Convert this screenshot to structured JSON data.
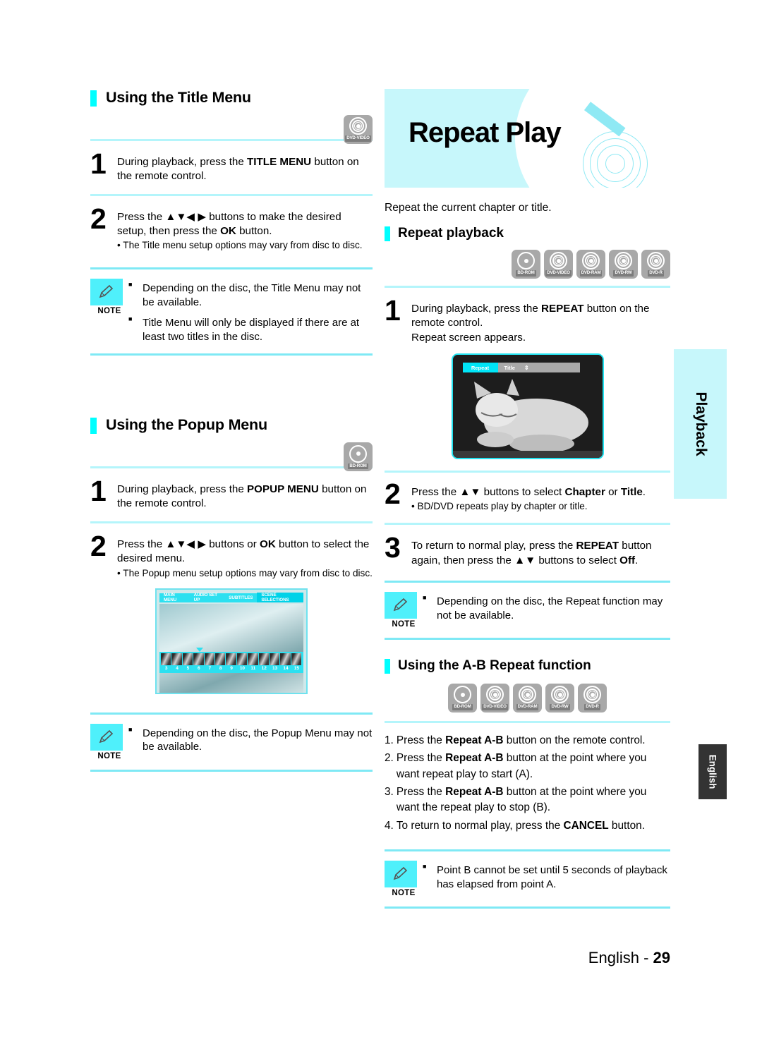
{
  "left_column": {
    "section1": {
      "heading": "Using the Title Menu",
      "disc_icon": "DVD-VIDEO",
      "steps": [
        {
          "num": "1",
          "text_parts": [
            "During playback, press the ",
            "TITLE MENU",
            " button on the remote control."
          ]
        },
        {
          "num": "2",
          "text_parts": [
            "Press the ▲▼◀ ▶ buttons to make the desired setup, then press the ",
            "OK",
            " button."
          ],
          "sub": "• The Title menu setup options may vary from disc to disc."
        }
      ],
      "note": {
        "label": "NOTE",
        "items": [
          "Depending on the disc, the Title Menu may not be available.",
          "Title Menu will only be displayed if there are at least two titles in the disc."
        ]
      }
    },
    "section2": {
      "heading": "Using the Popup Menu",
      "disc_icon": "BD-ROM",
      "steps": [
        {
          "num": "1",
          "text_parts": [
            "During playback, press the ",
            "POPUP MENU",
            " button on the remote control."
          ]
        },
        {
          "num": "2",
          "text_parts": [
            "Press the ▲▼◀ ▶ buttons or ",
            "OK",
            " button to select the desired menu."
          ],
          "sub": "• The Popup menu setup options may vary from disc to disc."
        }
      ],
      "screenshot": {
        "menu_tabs": [
          "MAIN MENU",
          "AUDIO SET UP",
          "SUBTITLES",
          "SCENE SELECTIONS"
        ],
        "active_tab": "SCENE SELECTIONS",
        "scene_numbers": [
          "3",
          "4",
          "5",
          "6",
          "7",
          "8",
          "9",
          "10",
          "11",
          "12",
          "13",
          "14",
          "15"
        ]
      },
      "note": {
        "label": "NOTE",
        "items": [
          "Depending on the disc, the Popup Menu may not be available."
        ]
      }
    }
  },
  "right_column": {
    "banner_title": "Repeat Play",
    "intro": "Repeat the current chapter or title.",
    "section1": {
      "heading": "Repeat playback",
      "disc_icons": [
        "BD-ROM",
        "DVD-VIDEO",
        "DVD-RAM",
        "DVD-RW",
        "DVD-R"
      ],
      "steps": [
        {
          "num": "1",
          "text_parts": [
            "During playback, press the ",
            "REPEAT",
            " button on the remote control."
          ],
          "extra": "Repeat screen appears."
        },
        {
          "num": "2",
          "text_parts": [
            "Press the ▲▼ buttons to select ",
            "Chapter",
            " or ",
            "Title",
            "."
          ],
          "sub": "• BD/DVD repeats play by chapter or title."
        },
        {
          "num": "3",
          "text_parts": [
            "To return to normal play, press the ",
            "REPEAT",
            " button again, then press the ▲▼ buttons to select ",
            "Off",
            "."
          ]
        }
      ],
      "screenshot_osd": {
        "tab": "Repeat",
        "value": "Title",
        "updown": "⇕"
      },
      "note": {
        "label": "NOTE",
        "items": [
          "Depending on the disc, the Repeat function may not be available."
        ]
      }
    },
    "section2": {
      "heading": "Using the A-B Repeat function",
      "disc_icons": [
        "BD-ROM",
        "DVD-VIDEO",
        "DVD-RAM",
        "DVD-RW",
        "DVD-R"
      ],
      "list": [
        {
          "n": "1.",
          "parts": [
            "Press the ",
            "Repeat A-B",
            " button on the remote control."
          ]
        },
        {
          "n": "2.",
          "parts": [
            "Press the ",
            "Repeat A-B",
            " button at the point where you want repeat play to start (A)."
          ]
        },
        {
          "n": "3.",
          "parts": [
            "Press the ",
            "Repeat A-B",
            " button at the point where you want the repeat play to stop (B)."
          ]
        },
        {
          "n": "4.",
          "parts": [
            "To return to normal play, press the ",
            "CANCEL",
            " button."
          ]
        }
      ],
      "note": {
        "label": "NOTE",
        "items": [
          "Point B cannot be set until 5 seconds of playback has elapsed from point A."
        ]
      }
    }
  },
  "side_tabs": {
    "playback": "Playback",
    "english": "English"
  },
  "footer": {
    "language": "English - ",
    "page": "29"
  },
  "colors": {
    "accent_cyan": "#00ffff",
    "banner_bg": "#c7f7fb",
    "rule": "#b4f5fb",
    "disc_gray": "#a8a8a8",
    "tab_dark": "#333333"
  }
}
